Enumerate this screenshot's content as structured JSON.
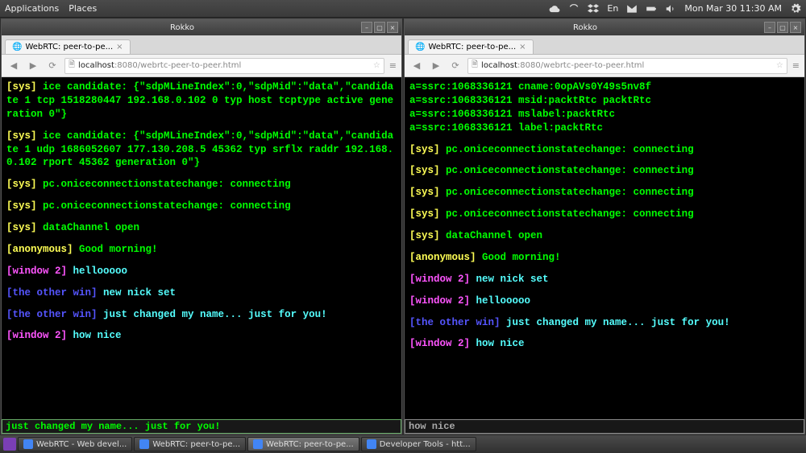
{
  "osbar": {
    "menu_applications": "Applications",
    "menu_places": "Places",
    "lang": "En",
    "clock": "Mon Mar 30 11:30 AM"
  },
  "left_window": {
    "titlebar_app": "Rokko",
    "tab_label": "WebRTC: peer-to-pe...",
    "url_host": "localhost",
    "url_port": ":8080",
    "url_path": "/webrtc-peer-to-peer.html",
    "lines": [
      {
        "cls": "sys",
        "prefix": "[sys]",
        "body": " ice candidate: {\"sdpMLineIndex\":0,\"sdpMid\":\"data\",\"candidate 1 tcp 1518280447 192.168.0.102 0 typ host tcptype active generation 0\"}"
      },
      {
        "cls": "gap"
      },
      {
        "cls": "sys",
        "prefix": "[sys]",
        "body": " ice candidate: {\"sdpMLineIndex\":0,\"sdpMid\":\"data\",\"candidate 1 udp 1686052607 177.130.208.5 45362 typ srflx raddr 192.168.0.102 rport 45362 generation 0\"}"
      },
      {
        "cls": "gap"
      },
      {
        "cls": "sys",
        "prefix": "[sys]",
        "body": " pc.oniceconnectionstatechange: connecting"
      },
      {
        "cls": "gap"
      },
      {
        "cls": "sys",
        "prefix": "[sys]",
        "body": " pc.oniceconnectionstatechange: connecting"
      },
      {
        "cls": "gap"
      },
      {
        "cls": "sys",
        "prefix": "[sys]",
        "body": " dataChannel open"
      },
      {
        "cls": "gap"
      },
      {
        "cls": "anon",
        "prefix": "[anonymous]",
        "body": " Good morning!"
      },
      {
        "cls": "gap"
      },
      {
        "cls": "win2",
        "prefix": "[window 2]",
        "body": " hellooooo"
      },
      {
        "cls": "gap"
      },
      {
        "cls": "other",
        "prefix": "[the other win]",
        "body": " new nick set"
      },
      {
        "cls": "gap"
      },
      {
        "cls": "other",
        "prefix": "[the other win]",
        "body": " just changed my name... just for you!"
      },
      {
        "cls": "gap"
      },
      {
        "cls": "win2",
        "prefix": "[window 2]",
        "body": " how nice"
      }
    ],
    "input_value": "just changed my name... just for you!"
  },
  "right_window": {
    "titlebar_app": "Rokko",
    "tab_label": "WebRTC: peer-to-pe...",
    "url_host": "localhost",
    "url_port": ":8080",
    "url_path": "/webrtc-peer-to-peer.html",
    "lines": [
      {
        "cls": "body",
        "body": "a=ssrc:1068336121 cname:0opAVs0Y49s5nv8f"
      },
      {
        "cls": "body",
        "body": "a=ssrc:1068336121 msid:packtRtc packtRtc"
      },
      {
        "cls": "body",
        "body": "a=ssrc:1068336121 mslabel:packtRtc"
      },
      {
        "cls": "body",
        "body": "a=ssrc:1068336121 label:packtRtc"
      },
      {
        "cls": "gap"
      },
      {
        "cls": "sys",
        "prefix": "[sys]",
        "body": " pc.oniceconnectionstatechange: connecting"
      },
      {
        "cls": "gap"
      },
      {
        "cls": "sys",
        "prefix": "[sys]",
        "body": " pc.oniceconnectionstatechange: connecting"
      },
      {
        "cls": "gap"
      },
      {
        "cls": "sys",
        "prefix": "[sys]",
        "body": " pc.oniceconnectionstatechange: connecting"
      },
      {
        "cls": "gap"
      },
      {
        "cls": "sys",
        "prefix": "[sys]",
        "body": " pc.oniceconnectionstatechange: connecting"
      },
      {
        "cls": "gap"
      },
      {
        "cls": "sys",
        "prefix": "[sys]",
        "body": " dataChannel open"
      },
      {
        "cls": "gap"
      },
      {
        "cls": "anon",
        "prefix": "[anonymous]",
        "body": " Good morning!"
      },
      {
        "cls": "gap"
      },
      {
        "cls": "win2",
        "prefix": "[window 2]",
        "body": " new nick set"
      },
      {
        "cls": "gap"
      },
      {
        "cls": "win2",
        "prefix": "[window 2]",
        "body": " hellooooo"
      },
      {
        "cls": "gap"
      },
      {
        "cls": "other",
        "prefix": "[the other win]",
        "body": " just changed my name... just for you!"
      },
      {
        "cls": "gap"
      },
      {
        "cls": "win2",
        "prefix": "[window 2]",
        "body": " how nice"
      }
    ],
    "input_value": "how nice"
  },
  "taskbar": {
    "items": [
      {
        "label": "WebRTC - Web devel...",
        "active": false
      },
      {
        "label": "WebRTC: peer-to-pe...",
        "active": false
      },
      {
        "label": "WebRTC: peer-to-pe...",
        "active": true
      },
      {
        "label": "Developer Tools - htt...",
        "active": false
      }
    ]
  }
}
